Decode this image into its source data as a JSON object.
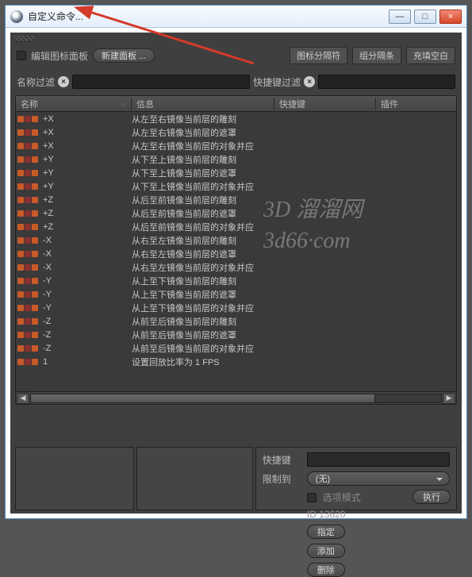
{
  "window": {
    "title": "自定义命令...",
    "min_glyph": "—",
    "max_glyph": "□",
    "close_glyph": "×"
  },
  "toolbar": {
    "edit_icons_label": "编辑图标面板",
    "new_panel_label": "新建面板 ...",
    "icon_sep_label": "图标分隔符",
    "group_sep_label": "组分隔条",
    "fill_blank_label": "充填空白"
  },
  "filters": {
    "name_label": "名称过滤",
    "shortcut_label": "快捷键过滤"
  },
  "columns": {
    "name": "名称",
    "info": "信息",
    "shortcut": "快捷键",
    "plugin": "插件"
  },
  "rows": [
    {
      "name": "+X",
      "info": "从左至右镜像当前层的雕刻"
    },
    {
      "name": "+X",
      "info": "从左至右镜像当前层的遮罩"
    },
    {
      "name": "+X",
      "info": "从左至右镜像当前层的对象并应"
    },
    {
      "name": "+Y",
      "info": "从下至上镜像当前层的雕刻"
    },
    {
      "name": "+Y",
      "info": "从下至上镜像当前层的遮罩"
    },
    {
      "name": "+Y",
      "info": "从下至上镜像当前层的对象并应"
    },
    {
      "name": "+Z",
      "info": "从后至前镜像当前层的雕刻"
    },
    {
      "name": "+Z",
      "info": "从后至前镜像当前层的遮罩"
    },
    {
      "name": "+Z",
      "info": "从后至前镜像当前层的对象并应"
    },
    {
      "name": "-X",
      "info": "从右至左镜像当前层的雕刻"
    },
    {
      "name": "-X",
      "info": "从右至左镜像当前层的遮罩"
    },
    {
      "name": "-X",
      "info": "从右至左镜像当前层的对象并应"
    },
    {
      "name": "-Y",
      "info": "从上至下镜像当前层的雕刻"
    },
    {
      "name": "-Y",
      "info": "从上至下镜像当前层的遮罩"
    },
    {
      "name": "-Y",
      "info": "从上至下镜像当前层的对象并应"
    },
    {
      "name": "-Z",
      "info": "从前至后镜像当前层的雕刻"
    },
    {
      "name": "-Z",
      "info": "从前至后镜像当前层的遮罩"
    },
    {
      "name": "-Z",
      "info": "从前至后镜像当前层的对象并应"
    },
    {
      "name": "1",
      "info": "设置回放比率为 1 FPS"
    }
  ],
  "detail": {
    "shortcut_label": "快捷键",
    "limit_label": "限制到",
    "limit_value": "(无)",
    "option_mode_label": "选项模式",
    "id_label": "ID 13620",
    "assign_label": "指定",
    "add_label": "添加",
    "delete_label": "删除",
    "execute_label": "执行"
  },
  "watermark": {
    "line1": "3D 溜溜网",
    "line2": "3d66·com"
  }
}
